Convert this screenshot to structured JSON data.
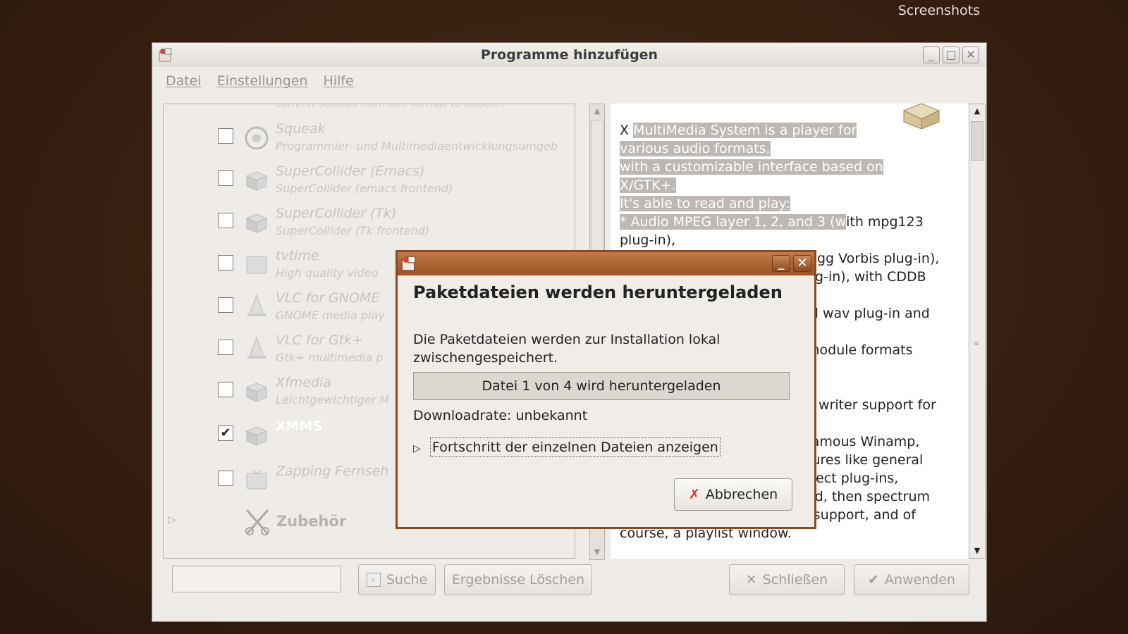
{
  "desktop": {
    "label": "Screenshots"
  },
  "window": {
    "title": "Programme hinzufügen",
    "controls": {
      "minimize": "_",
      "maximize": "□",
      "close": "✕"
    }
  },
  "menu": [
    {
      "label": "Datei"
    },
    {
      "label": "Einstellungen"
    },
    {
      "label": "Hilfe"
    }
  ],
  "app_list": {
    "partial_top_text": "convert sounds from one format to another",
    "items": [
      {
        "name": "Squeak",
        "description": "Programmier- und Multimediaentwicklungsumgeb",
        "checked": false,
        "icon": "squeak-icon"
      },
      {
        "name": "SuperCollider (Emacs)",
        "description": "SuperCollider (emacs frontend)",
        "checked": false,
        "icon": "package-icon"
      },
      {
        "name": "SuperCollider (Tk)",
        "description": "SuperCollider (Tk frontend)",
        "checked": false,
        "icon": "package-icon"
      },
      {
        "name": "tvtime",
        "description": "High quality video",
        "checked": false,
        "icon": "tv-icon"
      },
      {
        "name": "VLC for GNOME",
        "description": "GNOME media play",
        "checked": false,
        "icon": "vlc-cone-icon"
      },
      {
        "name": "VLC for Gtk+",
        "description": "Gtk+ multimedia p",
        "checked": false,
        "icon": "vlc-cone-icon"
      },
      {
        "name": "Xfmedia",
        "description": "Leichtgewichtiger M",
        "checked": false,
        "icon": "package-icon"
      },
      {
        "name": "XMMS",
        "description": "",
        "checked": true,
        "icon": "package-icon"
      },
      {
        "name": "Zapping Fernseh",
        "description": "",
        "checked": false,
        "icon": "tv-icon"
      }
    ],
    "category": {
      "name": "Zubehör",
      "icon": "accessories-icon"
    }
  },
  "description": {
    "highlighted_lines": [
      "MultiMedia System is a player for",
      "various audio formats,",
      "with a customizable interface based on",
      "X/GTK+.",
      "It's able to read and play:",
      "* Audio MPEG layer 1, 2, and 3 (w"
    ],
    "first_char": "X",
    "lines": [
      "ith mpg123",
      "plug-in),",
      "Ogg Vorbis plug-in),",
      "ug-in), with CDDB",
      "",
      "al wav plug-in and",
      "",
      "module formats",
      "",
      "",
      "k writer support for",
      "",
      "famous Winamp,",
      "tures like general",
      "ffect plug-ins,",
      "ed, then spectrum",
      "analyzer, oscilloscope, skins support, and of",
      "course, a playlist window."
    ]
  },
  "bottom": {
    "search_input": "",
    "search_label": "Suche",
    "clear_label": "Ergebnisse Löschen",
    "close_label": "Schließen",
    "apply_label": "Anwenden"
  },
  "dialog": {
    "heading": "Paketdateien werden heruntergeladen",
    "message": "Die Paketdateien werden zur Installation lokal zwischengespeichert.",
    "progress_text": "Datei 1 von 4 wird heruntergeladen",
    "progress_fraction": 0.0,
    "rate": "Downloadrate: unbekannt",
    "expander_label": "Fortschritt der einzelnen Dateien anzeigen",
    "cancel_label": "Abbrechen"
  },
  "colors": {
    "dialog_titlebar": "#9a5226",
    "selection": "#bdb8b3"
  }
}
